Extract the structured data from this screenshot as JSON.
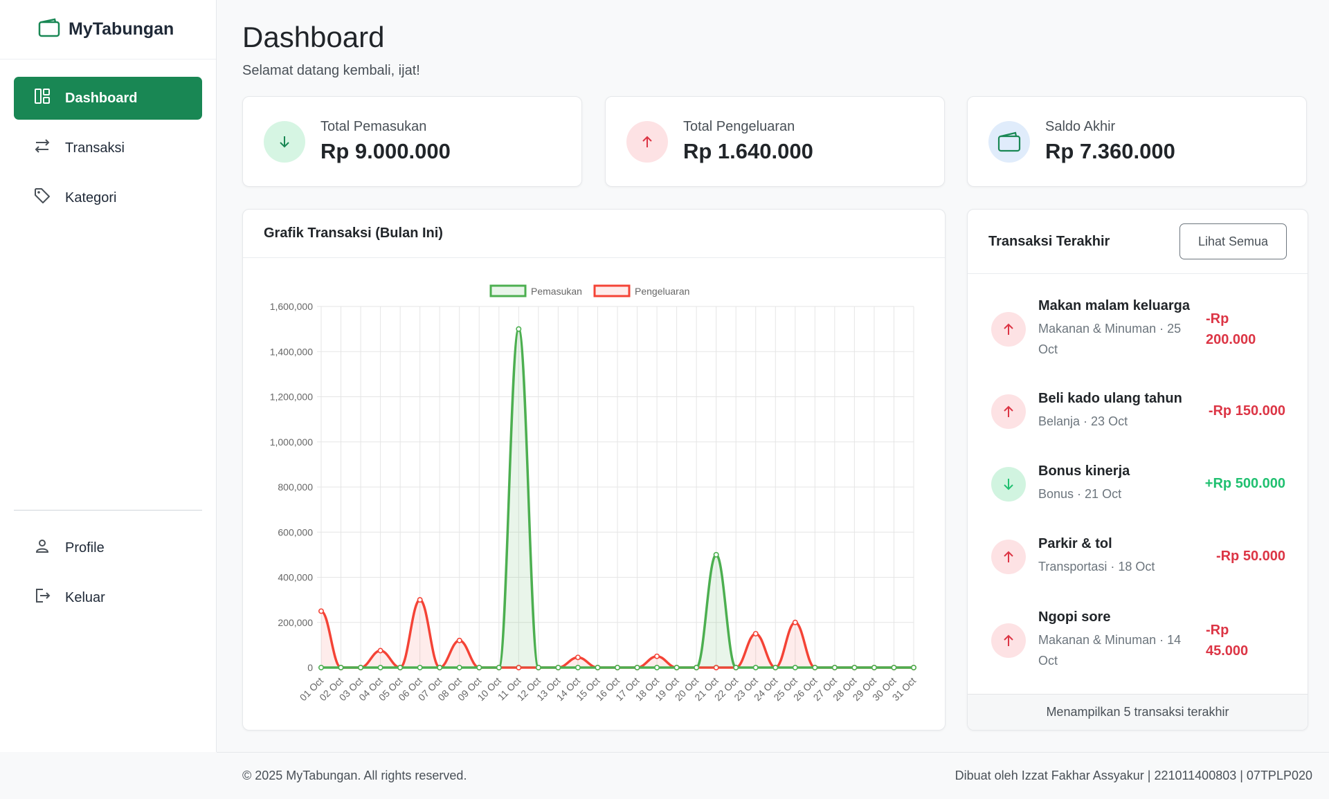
{
  "app": {
    "name": "MyTabungan"
  },
  "sidebar": {
    "items": [
      {
        "label": "Dashboard",
        "icon": "dashboard-icon",
        "active": true
      },
      {
        "label": "Transaksi",
        "icon": "transfer-icon"
      },
      {
        "label": "Kategori",
        "icon": "tag-icon"
      }
    ],
    "bottom": [
      {
        "label": "Profile",
        "icon": "user-icon"
      },
      {
        "label": "Keluar",
        "icon": "logout-icon"
      }
    ]
  },
  "header": {
    "title": "Dashboard",
    "subtitle": "Selamat datang kembali, ijat!"
  },
  "stats": {
    "income": {
      "label": "Total Pemasukan",
      "value": "Rp 9.000.000",
      "icon": "arrow-down-icon"
    },
    "expense": {
      "label": "Total Pengeluaran",
      "value": "Rp 1.640.000",
      "icon": "arrow-up-icon"
    },
    "balance": {
      "label": "Saldo Akhir",
      "value": "Rp 7.360.000",
      "icon": "wallet-icon"
    }
  },
  "chart": {
    "title": "Grafik Transaksi (Bulan Ini)"
  },
  "chart_data": {
    "type": "line",
    "title": "",
    "xlabel": "",
    "ylabel": "",
    "ylim": [
      0,
      1600000
    ],
    "yticks": [
      0,
      200000,
      400000,
      600000,
      800000,
      1000000,
      1200000,
      1400000,
      1600000
    ],
    "ytick_labels": [
      "0",
      "200,000",
      "400,000",
      "600,000",
      "800,000",
      "1,000,000",
      "1,200,000",
      "1,400,000",
      "1,600,000"
    ],
    "legend_position": "top",
    "grid": true,
    "categories": [
      "01 Oct",
      "02 Oct",
      "03 Oct",
      "04 Oct",
      "05 Oct",
      "06 Oct",
      "07 Oct",
      "08 Oct",
      "09 Oct",
      "10 Oct",
      "11 Oct",
      "12 Oct",
      "13 Oct",
      "14 Oct",
      "15 Oct",
      "16 Oct",
      "17 Oct",
      "18 Oct",
      "19 Oct",
      "20 Oct",
      "21 Oct",
      "22 Oct",
      "23 Oct",
      "24 Oct",
      "25 Oct",
      "26 Oct",
      "27 Oct",
      "28 Oct",
      "29 Oct",
      "30 Oct",
      "31 Oct"
    ],
    "series": [
      {
        "name": "Pemasukan",
        "color": "#4caf50",
        "fill": "rgba(76,175,80,0.12)",
        "values": [
          0,
          0,
          0,
          0,
          0,
          0,
          0,
          0,
          0,
          0,
          1500000,
          0,
          0,
          0,
          0,
          0,
          0,
          0,
          0,
          0,
          500000,
          0,
          0,
          0,
          0,
          0,
          0,
          0,
          0,
          0,
          0
        ]
      },
      {
        "name": "Pengeluaran",
        "color": "#f44336",
        "fill": "rgba(244,67,54,0.10)",
        "values": [
          250000,
          0,
          0,
          75000,
          0,
          300000,
          0,
          120000,
          0,
          0,
          0,
          0,
          0,
          45000,
          0,
          0,
          0,
          50000,
          0,
          0,
          0,
          0,
          150000,
          0,
          200000,
          0,
          0,
          0,
          0,
          0,
          0
        ]
      }
    ]
  },
  "recent": {
    "title": "Transaksi Terakhir",
    "view_all": "Lihat Semua",
    "items": [
      {
        "title": "Makan malam keluarga",
        "category": "Makanan & Minuman",
        "date": "25 Oct",
        "amount": "-Rp 200.000",
        "type": "out"
      },
      {
        "title": "Beli kado ulang tahun",
        "category": "Belanja",
        "date": "23 Oct",
        "amount": "-Rp 150.000",
        "type": "out"
      },
      {
        "title": "Bonus kinerja",
        "category": "Bonus",
        "date": "21 Oct",
        "amount": "+Rp 500.000",
        "type": "in"
      },
      {
        "title": "Parkir & tol",
        "category": "Transportasi",
        "date": "18 Oct",
        "amount": "-Rp 50.000",
        "type": "out"
      },
      {
        "title": "Ngopi sore",
        "category": "Makanan & Minuman",
        "date": "14 Oct",
        "amount": "-Rp 45.000",
        "type": "out"
      }
    ],
    "footer": "Menampilkan 5 transaksi terakhir"
  },
  "footer": {
    "copyright": "© 2025 MyTabungan. All rights reserved.",
    "credit": "Dibuat oleh Izzat Fakhar Assyakur | 221011400803 | 07TPLP020"
  },
  "colors": {
    "primary": "#198754",
    "income": "#20c070",
    "expense": "#dc3545"
  }
}
